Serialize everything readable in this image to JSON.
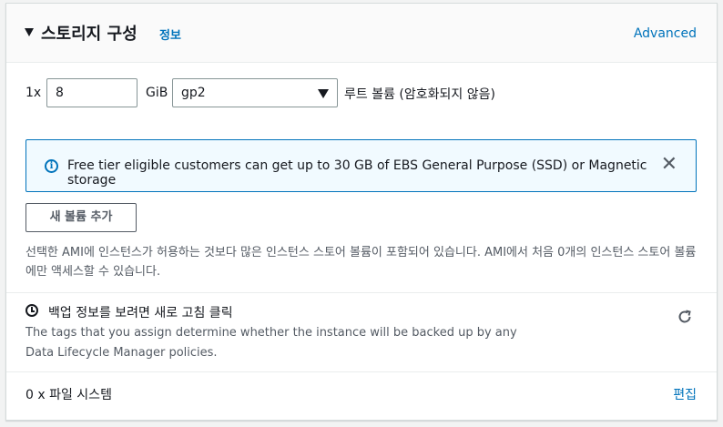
{
  "header": {
    "title": "스토리지 구성",
    "info_label": "정보",
    "advanced_label": "Advanced"
  },
  "root_volume": {
    "multiplier": "1x",
    "size_value": "8",
    "size_unit": "GiB",
    "volume_type": "gp2",
    "description": "루트 볼륨  (암호화되지 않음)"
  },
  "alert": {
    "icon": "info-icon",
    "text": "Free tier eligible customers can get up to 30 GB of EBS General Purpose (SSD) or Magnetic storage",
    "close_glyph": "✕",
    "color": "#0073bb"
  },
  "add_volume_label": "새 볼륨 추가",
  "instance_store_note": "선택한 AMI에 인스턴스가 허용하는 것보다 많은 인스턴스 스토어 볼륨이 포함되어 있습니다. AMI에서 처음 0개의 인스턴스 스토어 볼륨에만 액세스할 수 있습니다.",
  "backup": {
    "icon": "clock-icon",
    "title": "백업 정보를 보려면 새로 고침 클릭",
    "description": "The tags that you assign determine whether the instance will be backed up by any Data Lifecycle Manager policies.",
    "refresh_icon": "refresh-icon"
  },
  "file_systems": {
    "count_label": "0 x 파일 시스템",
    "edit_label": "편집"
  },
  "colors": {
    "link": "#0073bb",
    "alert_bg": "#f1faff"
  }
}
